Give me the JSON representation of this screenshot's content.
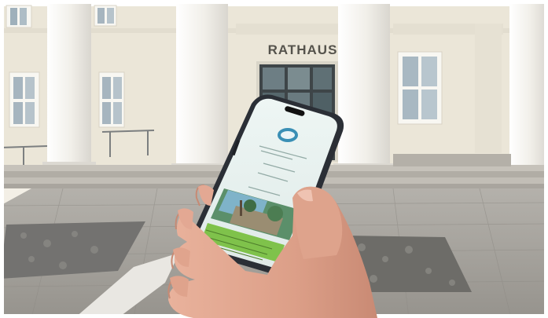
{
  "sign": {
    "text": "RATHAUS"
  },
  "colors": {
    "facade": "#ece7da",
    "column": "#f4f2ec",
    "pavement": "#a8a59f",
    "cobble": "#6f6e6a",
    "phone_body": "#2b2f36",
    "screen": "#e7f1ef",
    "skin": "#e0a48d",
    "caption_green": "#7fc24b"
  }
}
